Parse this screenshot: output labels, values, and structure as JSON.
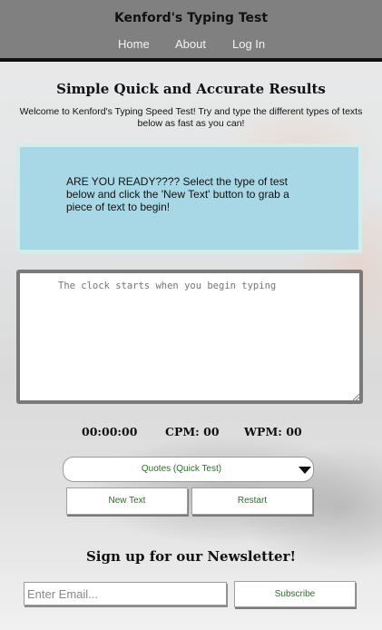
{
  "header": {
    "site_title": "Kenford's Typing Test",
    "nav": [
      "Home",
      "About",
      "Log In"
    ]
  },
  "hero": {
    "headline": "Simple Quick and Accurate Results",
    "intro": "Welcome to Kenford's Typing Speed Test! Try and type the different types of texts below as fast as you can!"
  },
  "prompt_box": {
    "text": "ARE YOU READY???? Select the type of test below and click the 'New Text' button to grab a piece of text to begin!"
  },
  "typing_area": {
    "placeholder": "The clock starts when you begin typing"
  },
  "stats": {
    "timer": "00:00:00",
    "cpm": "CPM: 00",
    "wpm": "WPM: 00"
  },
  "test_select": {
    "selected": "Quotes (Quick Test)"
  },
  "buttons": {
    "new_text": "New Text",
    "restart": "Restart"
  },
  "newsletter": {
    "title": "Sign up for our Newsletter!",
    "email_placeholder": "Enter Email...",
    "subscribe": "Subscribe"
  },
  "colors": {
    "header_bg": "#808080",
    "prompt_bg": "#a8d8e6",
    "button_text": "#2e6b2a"
  }
}
